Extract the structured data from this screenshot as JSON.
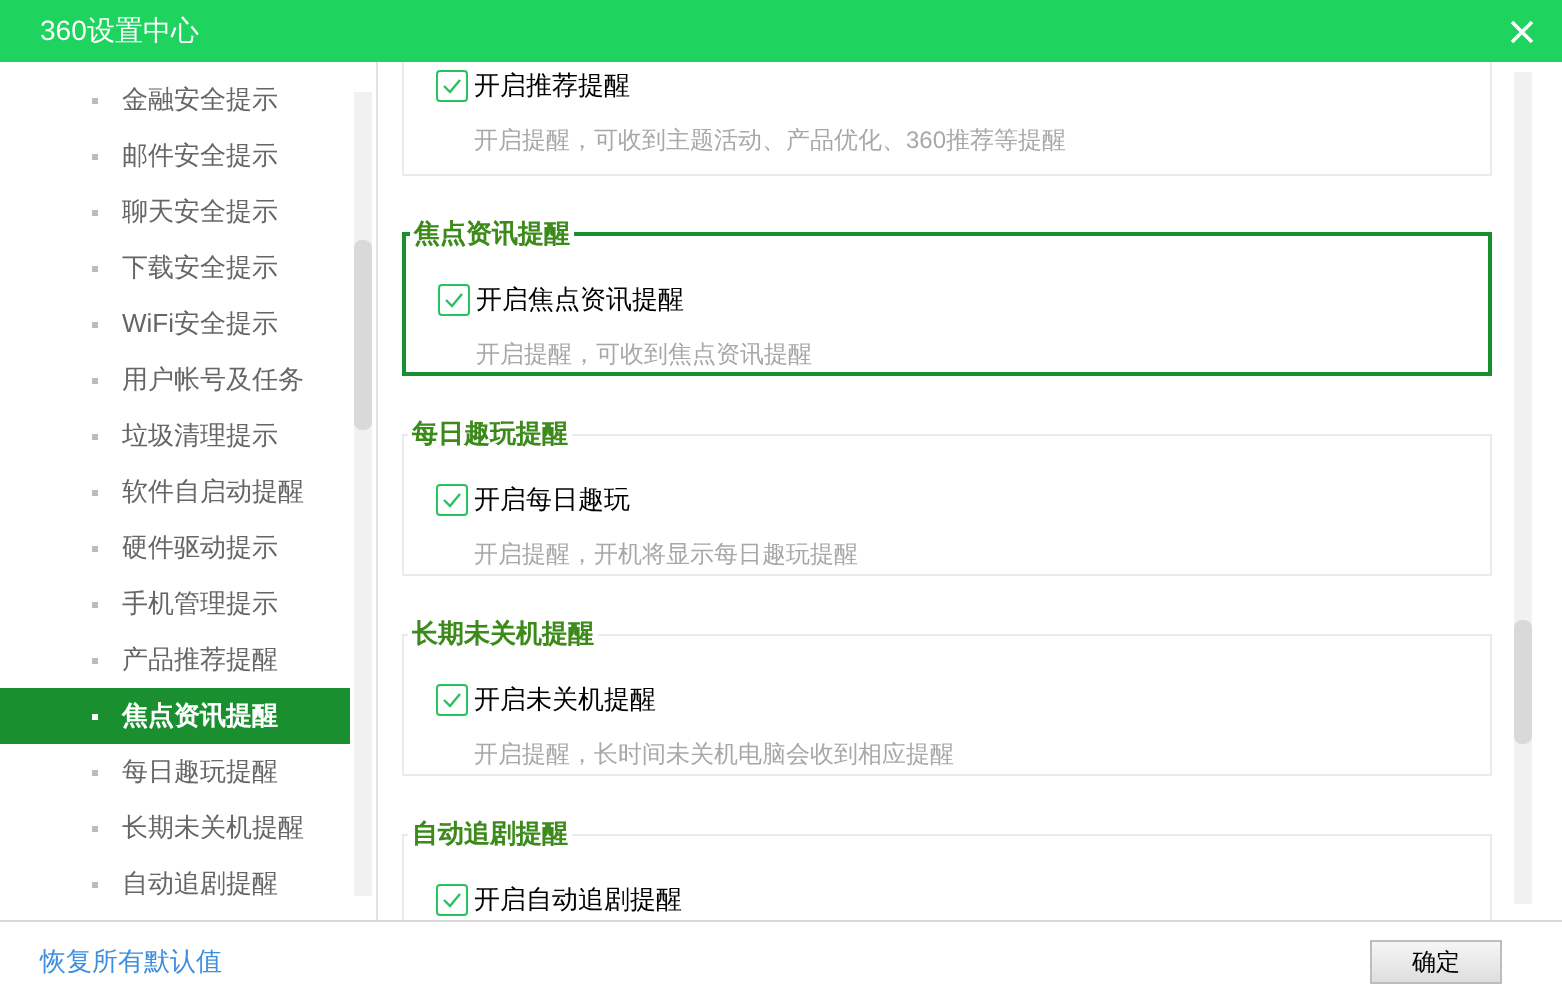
{
  "window": {
    "title": "360设置中心"
  },
  "sidebar": {
    "items": [
      {
        "label": "金融安全提示",
        "selected": false
      },
      {
        "label": "邮件安全提示",
        "selected": false
      },
      {
        "label": "聊天安全提示",
        "selected": false
      },
      {
        "label": "下载安全提示",
        "selected": false
      },
      {
        "label": "WiFi安全提示",
        "selected": false
      },
      {
        "label": "用户帐号及任务",
        "selected": false
      },
      {
        "label": "垃圾清理提示",
        "selected": false
      },
      {
        "label": "软件自启动提醒",
        "selected": false
      },
      {
        "label": "硬件驱动提示",
        "selected": false
      },
      {
        "label": "手机管理提示",
        "selected": false
      },
      {
        "label": "产品推荐提醒",
        "selected": false
      },
      {
        "label": "焦点资讯提醒",
        "selected": true
      },
      {
        "label": "每日趣玩提醒",
        "selected": false
      },
      {
        "label": "长期未关机提醒",
        "selected": false
      },
      {
        "label": "自动追剧提醒",
        "selected": false
      }
    ]
  },
  "groups": [
    {
      "selected": false,
      "option": {
        "label": "开启推荐提醒",
        "checked": true
      },
      "description": "开启提醒，可收到主题活动、产品优化、360推荐等提醒"
    },
    {
      "title": "焦点资讯提醒",
      "selected": true,
      "option": {
        "label": "开启焦点资讯提醒",
        "checked": true
      },
      "description": "开启提醒，可收到焦点资讯提醒"
    },
    {
      "title": "每日趣玩提醒",
      "selected": false,
      "option": {
        "label": "开启每日趣玩",
        "checked": true
      },
      "description": "开启提醒，开机将显示每日趣玩提醒"
    },
    {
      "title": "长期未关机提醒",
      "selected": false,
      "option": {
        "label": "开启未关机提醒",
        "checked": true
      },
      "description": "开启提醒，长时间未关机电脑会收到相应提醒"
    },
    {
      "title": "自动追剧提醒",
      "selected": false,
      "option": {
        "label": "开启自动追剧提醒",
        "checked": true
      }
    }
  ],
  "footer": {
    "restore_link": "恢复所有默认值",
    "ok_button": "确定"
  }
}
